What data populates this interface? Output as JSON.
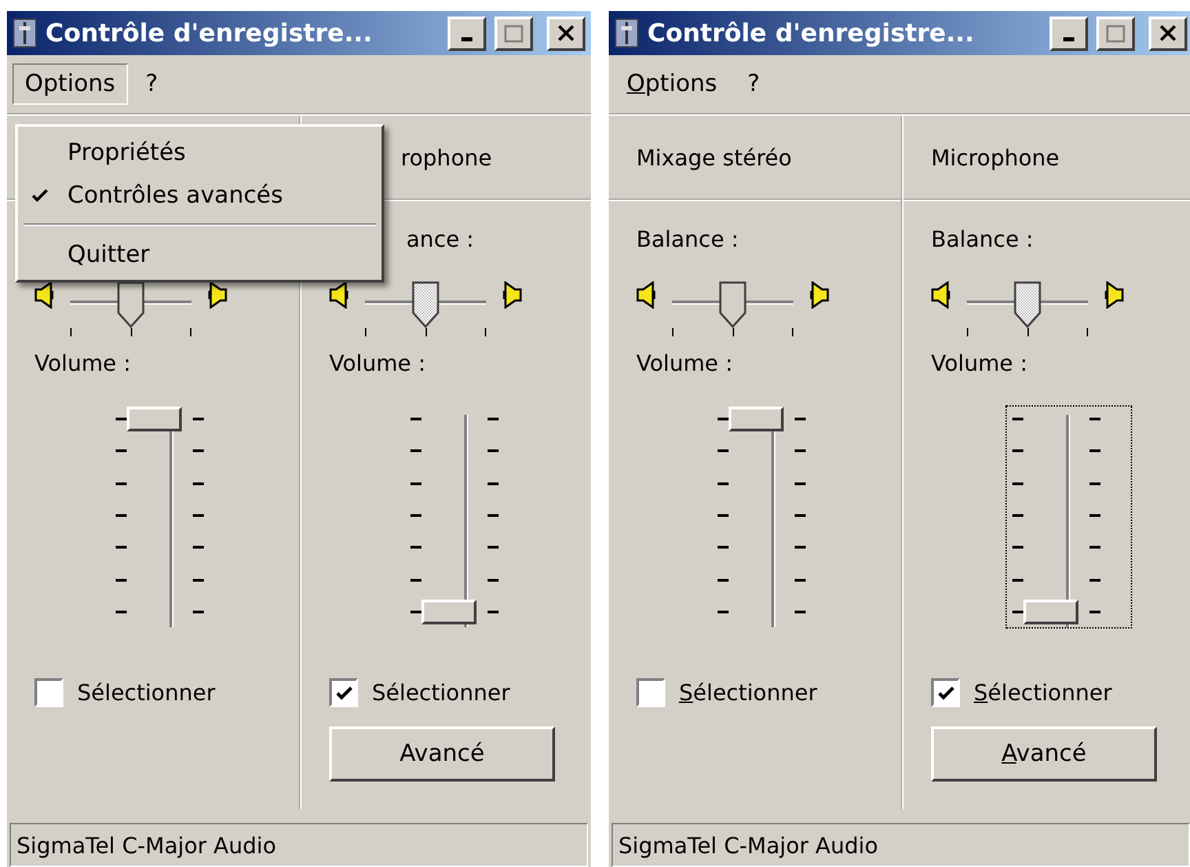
{
  "windows": [
    {
      "title": "Contrôle d'enregistre...",
      "show_access_keys": false,
      "menu": [
        {
          "label": "Options",
          "selected": true
        },
        {
          "label": "?",
          "selected": false
        }
      ],
      "dropdown": [
        {
          "kind": "item",
          "label": "Propriétés",
          "checked": false
        },
        {
          "kind": "item",
          "label": "Contrôles avancés",
          "checked": true
        },
        {
          "kind": "separator"
        },
        {
          "kind": "item",
          "label": "Quitter",
          "checked": false
        }
      ],
      "columns": [
        {
          "balance": {
            "level": 0.5,
            "disabled": false
          },
          "volume_label": "Volume :",
          "volume": {
            "level": 1,
            "focused": false
          },
          "select": {
            "label": "Sélectionner",
            "checked": false
          }
        },
        {
          "name": "rophone",
          "balance_label": "ance :",
          "balance": {
            "level": 0.5,
            "disabled": true
          },
          "volume_label": "Volume :",
          "volume": {
            "level": 0,
            "focused": false
          },
          "select": {
            "label": "Sélectionner",
            "checked": true
          },
          "button": "Avancé"
        }
      ],
      "status": "SigmaTel C-Major Audio"
    },
    {
      "title": "Contrôle d'enregistre...",
      "show_access_keys": true,
      "menu": [
        {
          "label": "Options",
          "selected": false
        },
        {
          "label": "?",
          "selected": false
        }
      ],
      "columns": [
        {
          "name": "Mixage stéréo",
          "balance_label": "Balance :",
          "balance": {
            "level": 0.5,
            "disabled": false
          },
          "volume_label": "Volume :",
          "volume": {
            "level": 1,
            "focused": false
          },
          "select": {
            "label": "Sélectionner",
            "checked": false
          }
        },
        {
          "name": "Microphone",
          "balance_label": "Balance :",
          "balance": {
            "level": 0.5,
            "disabled": true
          },
          "volume_label": "Volume :",
          "volume": {
            "level": 0,
            "focused": true
          },
          "select": {
            "label": "Sélectionner",
            "checked": true
          },
          "button": "Avancé"
        }
      ],
      "status": "SigmaTel C-Major Audio"
    }
  ]
}
